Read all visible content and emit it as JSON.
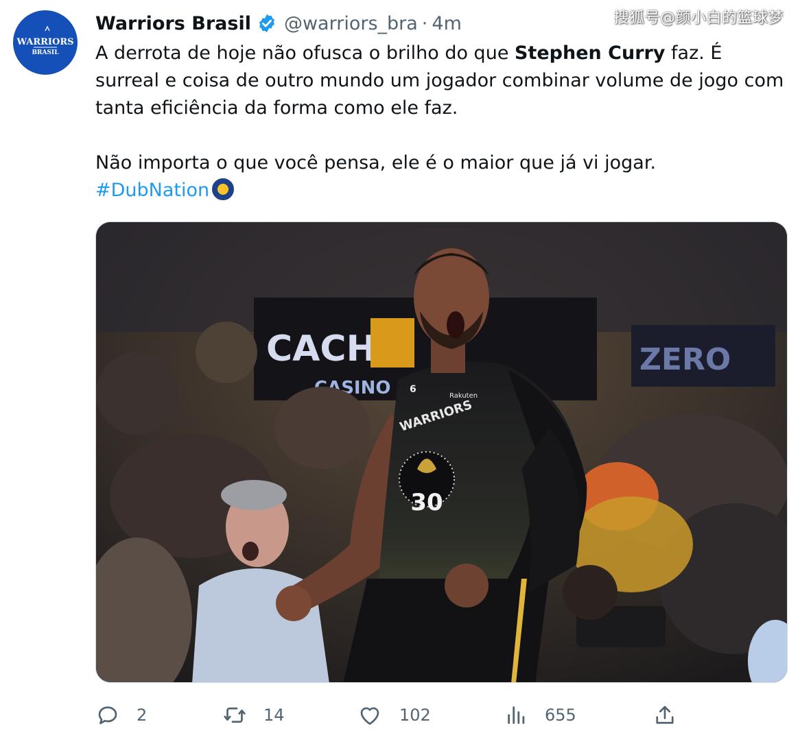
{
  "watermark": "搜狐号@颜小白的篮球梦",
  "tweet": {
    "author": {
      "display_name": "Warriors Brasil",
      "handle": "@warriors_bra",
      "separator": "·",
      "time": "4m",
      "verified": true,
      "avatar_text_line1": "WARRIORS",
      "avatar_text_line2": "BRASIL"
    },
    "text": {
      "line1_pre": "A derrota de hoje não ofusca o brilho do que ",
      "line1_bold": "Stephen Curry",
      "line1_post": " faz. É surreal e coisa de outro mundo um jogador combinar volume de jogo com tanta eficiência da forma como ele faz.",
      "paragraph2": "Não importa o que você pensa, ele é o maior que já vi jogar.",
      "hashtag": "#DubNation"
    },
    "media": {
      "jersey_top": "WARRIORS",
      "jersey_number": "30",
      "jersey_small_number": "6",
      "sponsor": "Rakuten",
      "arena_sign_1": "CACHE",
      "arena_sign_2": "CASINO R",
      "arena_sign_3": "ZERO"
    },
    "actions": {
      "replies": "2",
      "retweets": "14",
      "likes": "102",
      "views": "655"
    }
  },
  "colors": {
    "link": "#1d9bf0",
    "verified": "#1d9bf0",
    "secondary_text": "#536471",
    "avatar_bg": "#1550b8"
  },
  "icons": [
    "verified-badge-icon",
    "reply-icon",
    "retweet-icon",
    "like-icon",
    "views-icon",
    "share-icon"
  ]
}
